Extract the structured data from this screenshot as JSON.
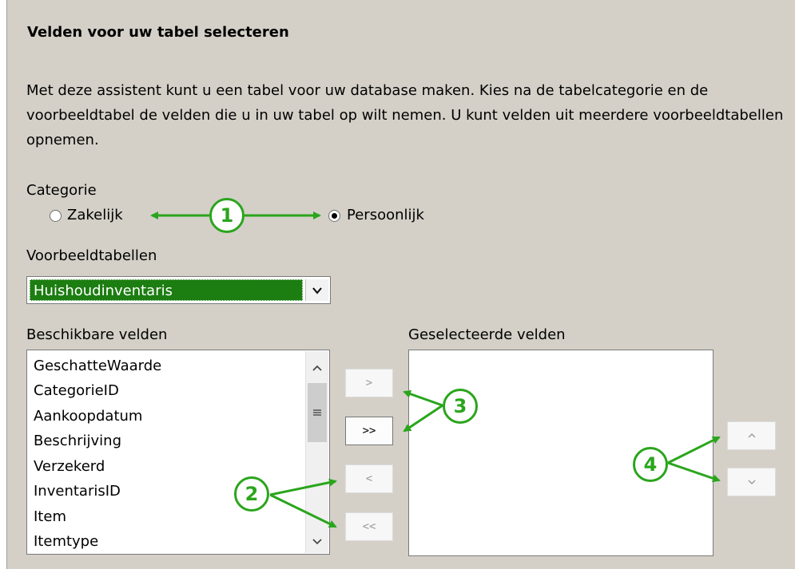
{
  "title": "Velden voor uw tabel selecteren",
  "description": "Met deze assistent kunt u een tabel voor uw database maken. Kies na de tabelcategorie en de voorbeeldtabel de velden die u in uw tabel op wilt nemen. U kunt velden uit meerdere voorbeeldtabellen opnemen.",
  "category": {
    "label": "Categorie",
    "options": [
      {
        "label": "Zakelijk",
        "selected": false
      },
      {
        "label": "Persoonlijk",
        "selected": true
      }
    ]
  },
  "sample_tables": {
    "label": "Voorbeeldtabellen",
    "selected": "Huishoudinventaris"
  },
  "available_fields": {
    "label": "Beschikbare velden",
    "items": [
      "GeschatteWaarde",
      "CategorieID",
      "Aankoopdatum",
      "Beschrijving",
      "Verzekerd",
      "InventarisID",
      "Item",
      "Itemtype"
    ]
  },
  "selected_fields": {
    "label": "Geselecteerde velden",
    "items": []
  },
  "move_buttons": {
    "add_one": ">",
    "add_all": ">>",
    "remove_one": "<",
    "remove_all": "<<"
  },
  "order_buttons": {
    "up": "^",
    "down": "v"
  },
  "callouts": [
    "1",
    "2",
    "3",
    "4"
  ],
  "colors": {
    "annotation": "#2aa51c",
    "selection": "#1c7d11",
    "background": "#d4d0c8"
  }
}
